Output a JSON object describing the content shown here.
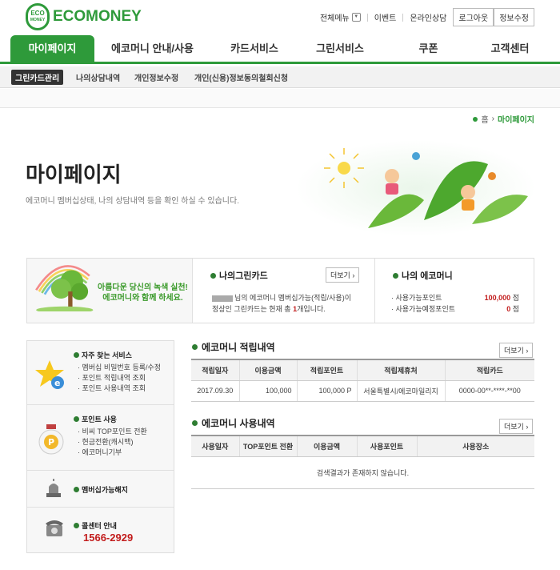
{
  "logo": {
    "badge_top": "ECO",
    "badge_bottom": "MONEY",
    "text": "ECOMONEY"
  },
  "utils": {
    "all_menu": "전체메뉴",
    "event": "이벤트",
    "consult": "온라인상담",
    "logout": "로그아웃",
    "edit_info": "정보수정"
  },
  "gnb": [
    "마이페이지",
    "에코머니 안내/사용",
    "카드서비스",
    "그린서비스",
    "쿠폰",
    "고객센터"
  ],
  "subnav": [
    "그린카드관리",
    "나의상담내역",
    "개인정보수정",
    "개인(신용)정보동의철회신청"
  ],
  "breadcrumb": {
    "home": "홈",
    "current": "마이페이지"
  },
  "hero": {
    "title": "마이페이지",
    "subtitle": "에코머니 멤버십상태, 나의 상담내역 등을 확인 하실 수 있습니다."
  },
  "slogan": {
    "line1": "아름다운 당신의 녹색 실천!",
    "line2": "에코머니와 함께 하세요."
  },
  "green_card": {
    "title": "나의그린카드",
    "more": "더보기",
    "line1": "님의 에코머니 멤버십가능(적립/사용)이",
    "line2a": "정상인 그린카드는 현재 총 ",
    "count": "1",
    "line2b": "개입니다."
  },
  "ecomoney": {
    "title": "나의 에코머니",
    "rows": [
      {
        "label": "· 사용가능포인트",
        "value": "100,000",
        "unit": "점"
      },
      {
        "label": "· 사용가능예정포인트",
        "value": "0",
        "unit": "점"
      }
    ]
  },
  "sidebar": {
    "faq_title": "자주 찾는 서비스",
    "faq_items": [
      "· 멤버십 비밀번호 등록/수정",
      "· 포인트 적립내역 조회",
      "· 포인트 사용내역 조회"
    ],
    "point_title": "포인트 사용",
    "point_items": [
      "· 비씨 TOP포인트 전환",
      "· 현금전환(캐시백)",
      "· 에코머니기부"
    ],
    "cancel_title": "멤버십가능해지",
    "call_title": "콜센터 안내",
    "phone": "1566-2929"
  },
  "accrual": {
    "title": "에코머니 적립내역",
    "more": "더보기",
    "headers": [
      "적립일자",
      "이용금액",
      "적립포인트",
      "적립제휴처",
      "적립카드"
    ],
    "rows": [
      [
        "2017.09.30",
        "100,000",
        "100,000 P",
        "서울특별시/에코마일리지",
        "0000-00**-****-**00"
      ]
    ]
  },
  "usage": {
    "title": "에코머니 사용내역",
    "more": "더보기",
    "headers": [
      "사용일자",
      "TOP포인트 전환",
      "이용금액",
      "사용포인트",
      "사용장소"
    ],
    "empty": "검색결과가 존재하지 않습니다."
  },
  "colors": {
    "brand_green": "#2e9a3a",
    "accent_red": "#c21c1c"
  }
}
